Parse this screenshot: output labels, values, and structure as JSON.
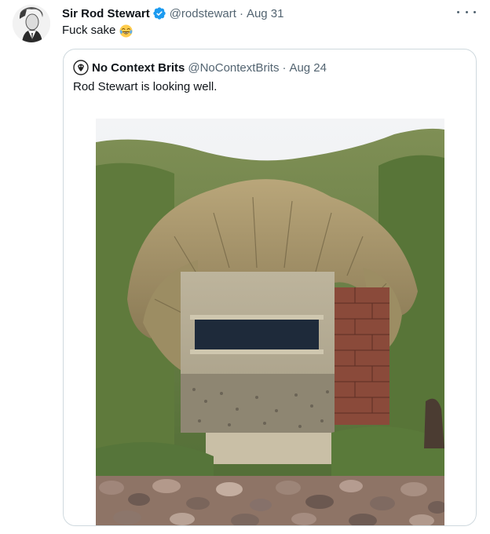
{
  "tweet": {
    "author_name": "Sir Rod Stewart",
    "author_handle": "@rodstewart",
    "separator": "·",
    "date": "Aug 31",
    "text": "Fuck sake",
    "emoji": "face-with-tears-of-joy",
    "verified": true
  },
  "quote": {
    "author_name": "No Context Brits",
    "author_handle": "@NoContextBrits",
    "separator": "·",
    "date": "Aug 24",
    "text": "Rod Stewart is looking well."
  },
  "icons": {
    "verified": "verified-badge-icon",
    "more": "more-options-icon"
  },
  "colors": {
    "verified_blue": "#1d9bf0",
    "secondary_text": "#536471",
    "border": "#cfd9de"
  }
}
